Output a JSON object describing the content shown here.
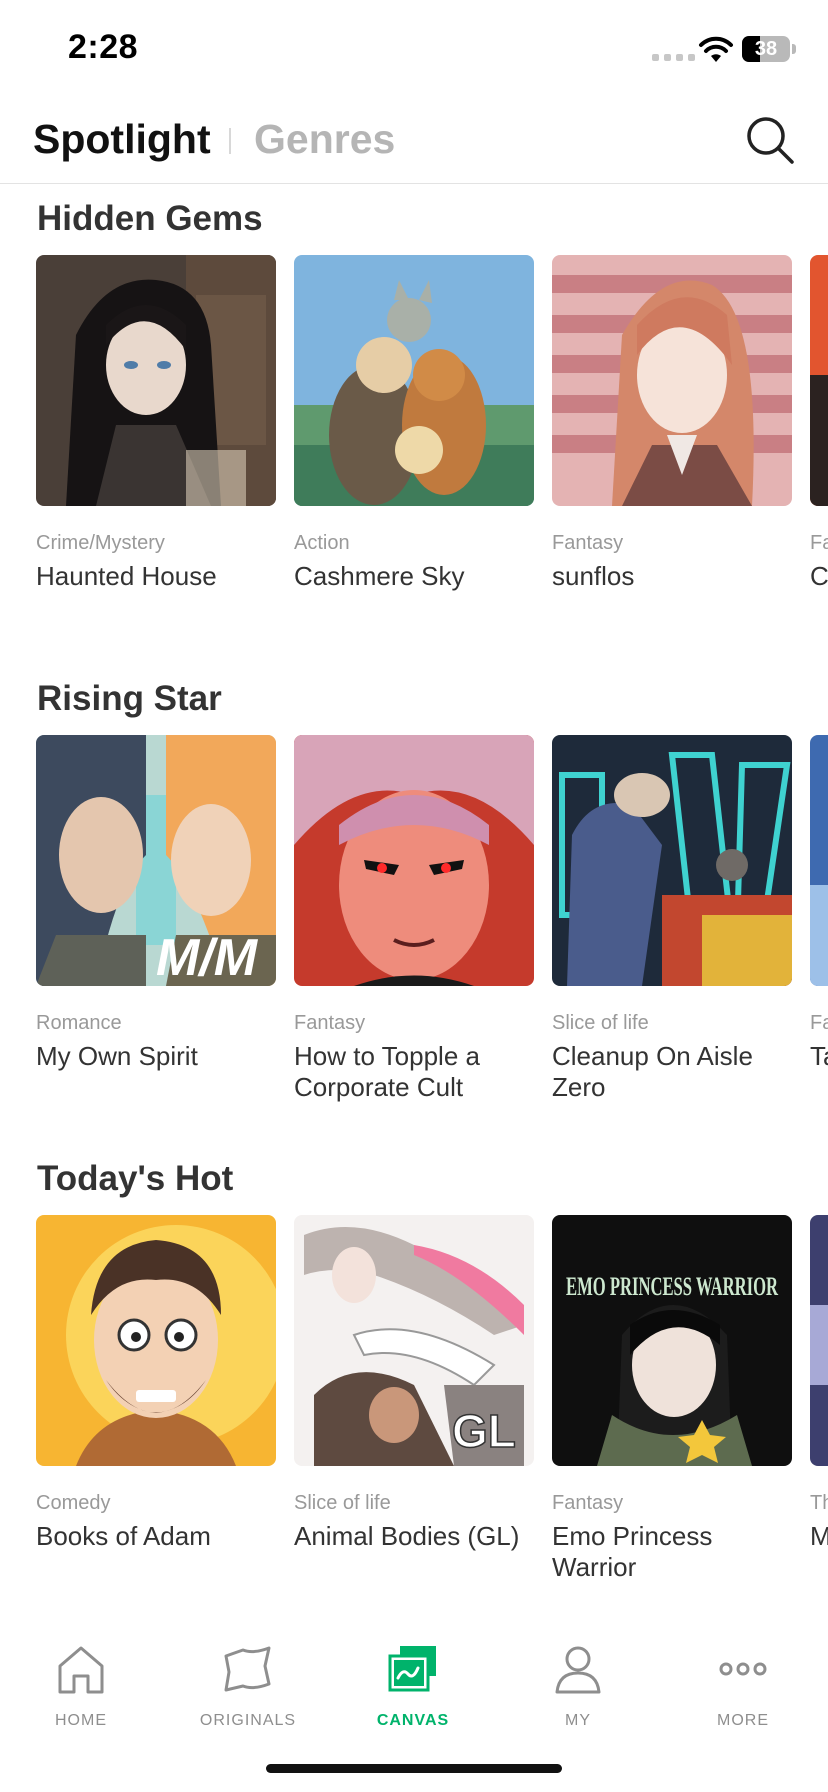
{
  "status_bar": {
    "time": "2:28",
    "battery_level": 38,
    "battery_text": "38"
  },
  "header": {
    "tabs": [
      {
        "label": "Spotlight",
        "active": true
      },
      {
        "label": "Genres",
        "active": false
      }
    ],
    "search_icon": "search-icon"
  },
  "sections": [
    {
      "title": "Hidden Gems",
      "items": [
        {
          "genre": "Crime/Mystery",
          "title": "Haunted House"
        },
        {
          "genre": "Action",
          "title": "Cashmere Sky"
        },
        {
          "genre": "Fantasy",
          "title": "sunflos"
        },
        {
          "genre": "Fa",
          "title": "C"
        }
      ]
    },
    {
      "title": "Rising Star",
      "items": [
        {
          "genre": "Romance",
          "title": "My Own Spirit",
          "cover_text": "M/M"
        },
        {
          "genre": "Fantasy",
          "title": "How to Topple a Corporate Cult"
        },
        {
          "genre": "Slice of life",
          "title": "Cleanup On Aisle Zero"
        },
        {
          "genre": "Fa",
          "title": "Ta"
        }
      ]
    },
    {
      "title": "Today's Hot",
      "items": [
        {
          "genre": "Comedy",
          "title": "Books of Adam"
        },
        {
          "genre": "Slice of life",
          "title": "Animal Bodies (GL)",
          "cover_text": "GL"
        },
        {
          "genre": "Fantasy",
          "title": "Emo Princess Warrior",
          "cover_text": "EMO PRINCESS WARRIOR"
        },
        {
          "genre": "Th",
          "title": "M a"
        }
      ]
    }
  ],
  "bottom_nav": [
    {
      "label": "HOME",
      "icon": "home-icon",
      "active": false
    },
    {
      "label": "ORIGINALS",
      "icon": "originals-icon",
      "active": false
    },
    {
      "label": "CANVAS",
      "icon": "canvas-icon",
      "active": true
    },
    {
      "label": "MY",
      "icon": "person-icon",
      "active": false
    },
    {
      "label": "MORE",
      "icon": "more-icon",
      "active": false
    }
  ],
  "colors": {
    "accent": "#00b36b",
    "inactive": "#8e8e8e",
    "title": "#333333"
  }
}
